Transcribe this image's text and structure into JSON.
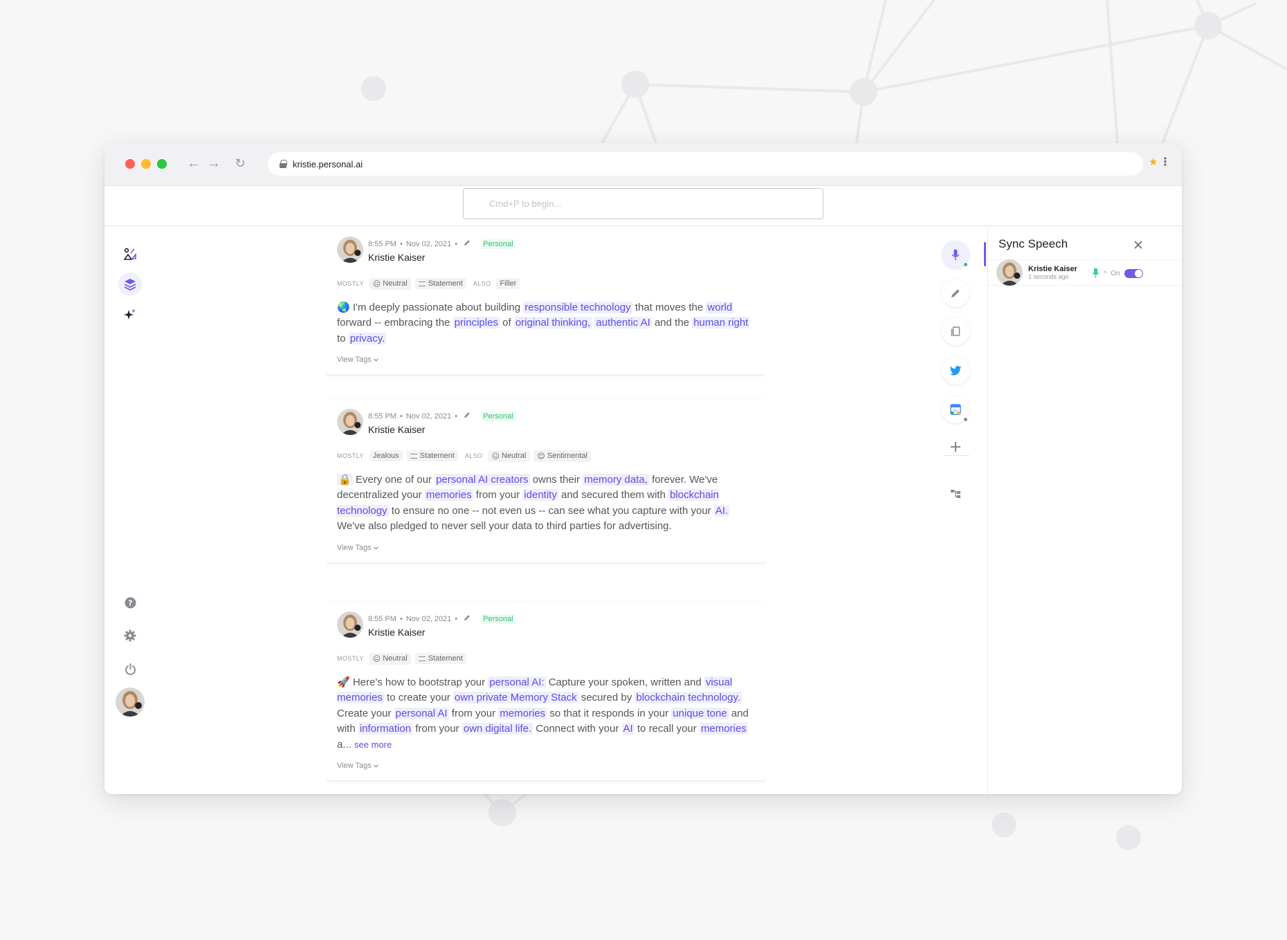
{
  "browser": {
    "url": "kristie.personal.ai"
  },
  "search": {
    "placeholder": "Cmd+P to begin..."
  },
  "colors": {
    "accent": "#6c5ce7",
    "highlight_text": "#5b4ee6",
    "highlight_bg": "#efeefc",
    "personal_tag": "#2fbf71"
  },
  "left_nav": {
    "items": [
      {
        "icon": "insights-icon"
      },
      {
        "icon": "layers-icon",
        "active": true
      },
      {
        "icon": "sparkle-icon"
      }
    ],
    "bottom": [
      {
        "icon": "help-icon"
      },
      {
        "icon": "gear-icon"
      },
      {
        "icon": "power-icon"
      }
    ]
  },
  "cards": [
    {
      "time": "8:55 PM",
      "date": "Nov 02, 2021",
      "tag": "Personal",
      "author": "Kristie Kaiser",
      "mostly_label": "MOSTLY",
      "also_label": "ALSO",
      "chips_mostly": [
        {
          "emoji": "😐",
          "label": "Neutral"
        },
        {
          "icon": "statement",
          "label": "Statement"
        }
      ],
      "chips_also": [
        {
          "label": "Filler"
        }
      ],
      "text": [
        {
          "t": "🌏 I'm deeply passionate about building "
        },
        {
          "t": "responsible technology",
          "hl": true
        },
        {
          "t": " that moves the "
        },
        {
          "t": "world",
          "hl": true
        },
        {
          "t": " forward -- embracing the "
        },
        {
          "t": "principles",
          "hl": true
        },
        {
          "t": " of "
        },
        {
          "t": "original thinking,",
          "hl": true
        },
        {
          "t": " "
        },
        {
          "t": "authentic AI",
          "hl": true
        },
        {
          "t": " and the "
        },
        {
          "t": "human right",
          "hl": true
        },
        {
          "t": " to "
        },
        {
          "t": "privacy.",
          "hl": true
        }
      ],
      "view_tags": "View Tags"
    },
    {
      "time": "8:55 PM",
      "date": "Nov 02, 2021",
      "tag": "Personal",
      "author": "Kristie Kaiser",
      "mostly_label": "MOSTLY",
      "also_label": "ALSO",
      "chips_mostly": [
        {
          "label": "Jealous"
        },
        {
          "icon": "statement",
          "label": "Statement"
        }
      ],
      "chips_also": [
        {
          "emoji": "😐",
          "label": "Neutral"
        },
        {
          "emoji": "😌",
          "label": "Sentimental"
        }
      ],
      "text": [
        {
          "t": "🔒",
          "hl": true
        },
        {
          "t": " Every one of our "
        },
        {
          "t": "personal AI creators",
          "hl": true
        },
        {
          "t": " owns their "
        },
        {
          "t": "memory data,",
          "hl": true
        },
        {
          "t": " forever. We've decentralized your "
        },
        {
          "t": "memories",
          "hl": true
        },
        {
          "t": " from your "
        },
        {
          "t": "identity",
          "hl": true
        },
        {
          "t": " and secured them with "
        },
        {
          "t": "blockchain technology",
          "hl": true
        },
        {
          "t": " to ensure no one -- not even us -- can see what you capture with your "
        },
        {
          "t": "AI.",
          "hl": true
        },
        {
          "t": " We've also pledged to never sell your data to third parties for advertising."
        }
      ],
      "view_tags": "View Tags"
    },
    {
      "time": "8:55 PM",
      "date": "Nov 02, 2021",
      "tag": "Personal",
      "author": "Kristie Kaiser",
      "mostly_label": "MOSTLY",
      "also_label": "",
      "chips_mostly": [
        {
          "emoji": "😐",
          "label": "Neutral"
        },
        {
          "icon": "statement",
          "label": "Statement"
        }
      ],
      "chips_also": [],
      "text": [
        {
          "t": "🚀 Here's how to bootstrap your "
        },
        {
          "t": "personal AI:",
          "hl": true
        },
        {
          "t": " Capture your spoken, written and "
        },
        {
          "t": "visual memories",
          "hl": true
        },
        {
          "t": " to create your "
        },
        {
          "t": "own private Memory Stack",
          "hl": true
        },
        {
          "t": " secured by "
        },
        {
          "t": "blockchain technology.",
          "hl": true
        },
        {
          "t": " Create your "
        },
        {
          "t": "personal AI",
          "hl": true
        },
        {
          "t": " from your "
        },
        {
          "t": "memories",
          "hl": true
        },
        {
          "t": " so that it responds in your "
        },
        {
          "t": "unique tone",
          "hl": true
        },
        {
          "t": " and with "
        },
        {
          "t": "information",
          "hl": true
        },
        {
          "t": " from your "
        },
        {
          "t": "own digital life.",
          "hl": true
        },
        {
          "t": " Connect with your "
        },
        {
          "t": "AI",
          "hl": true
        },
        {
          "t": " to recall your "
        },
        {
          "t": "memories",
          "hl": true
        },
        {
          "t": " a... "
        }
      ],
      "see_more": "see more",
      "view_tags": "View Tags"
    }
  ],
  "tools": [
    {
      "icon": "microphone-icon",
      "active": true,
      "badge": "#2fbf71"
    },
    {
      "icon": "pencil-icon"
    },
    {
      "icon": "copy-icon"
    },
    {
      "icon": "twitter-icon"
    },
    {
      "icon": "calendar-icon",
      "badge": "#888888"
    },
    {
      "icon": "plus-icon"
    },
    {
      "icon": "hierarchy-icon"
    }
  ],
  "panel": {
    "title": "Sync Speech",
    "speaker": {
      "name": "Kristie Kaiser",
      "time": "1 seconds ago",
      "toggle_label": "On",
      "toggle_on": true
    }
  }
}
